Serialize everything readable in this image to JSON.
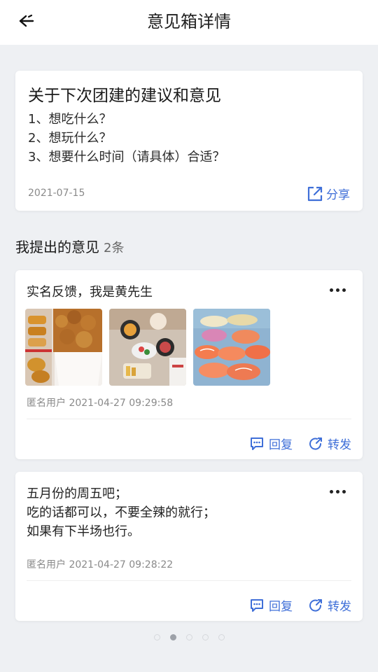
{
  "header": {
    "title": "意见箱详情",
    "back_icon": "back-arrow-icon"
  },
  "topic": {
    "title": "关于下次团建的建议和意见",
    "lines": [
      "1、想吃什么？",
      "2、想玩什么？",
      "3、想要什么时间（请具体）合适？"
    ],
    "date": "2021-07-15",
    "share_label": "分享",
    "share_icon": "share-icon"
  },
  "section": {
    "title": "我提出的意见",
    "count": "2条"
  },
  "opinions": [
    {
      "text": "实名反馈，我是黄先生",
      "meta": "匿名用户 2021-04-27 09:29:58",
      "photos": [
        "fried-chicken-box-photo",
        "table-food-photo",
        "sashimi-platter-photo"
      ],
      "reply_label": "回复",
      "forward_label": "转发"
    },
    {
      "lines": [
        "五月份的周五吧；",
        "吃的话都可以，不要全辣的就行；",
        "如果有下半场也行。"
      ],
      "meta": "匿名用户 2021-04-27 09:28:22",
      "reply_label": "回复",
      "forward_label": "转发"
    }
  ],
  "pagination": {
    "total": 5,
    "active": 2
  },
  "colors": {
    "accent": "#3f6fd8",
    "background": "#eef0f3",
    "card": "#ffffff"
  }
}
